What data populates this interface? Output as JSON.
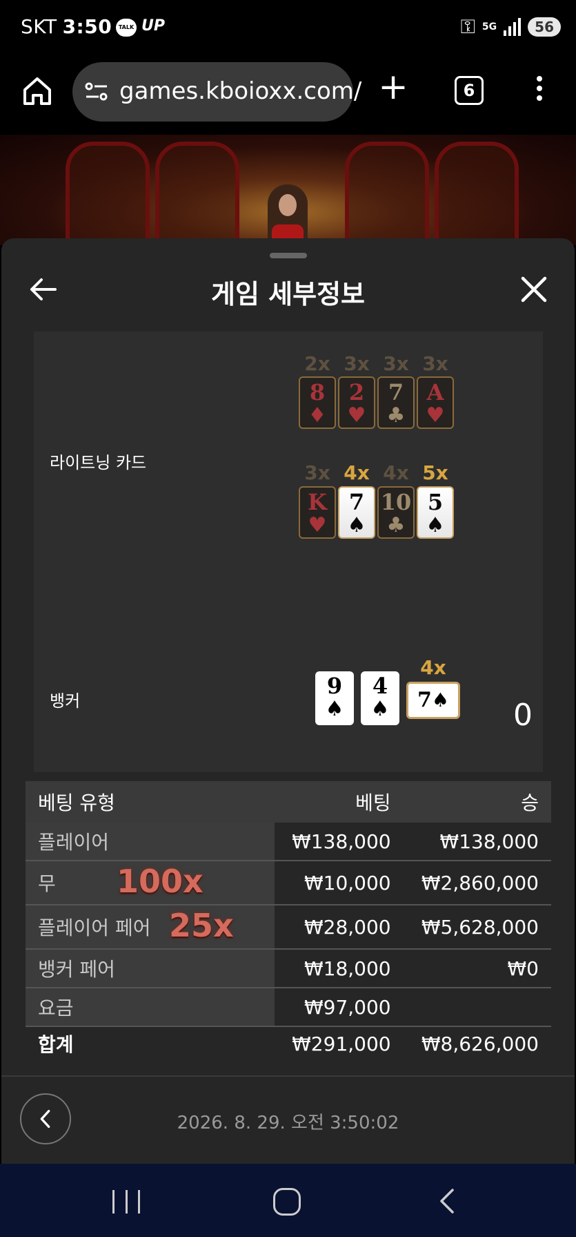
{
  "status_bar": {
    "carrier": "SKT",
    "time": "3:50",
    "talk_badge": "TALK",
    "up_badge": "UP",
    "network": "5G",
    "battery": "56"
  },
  "browser": {
    "url": "games.kboioxx.com/",
    "tab_count": "6"
  },
  "panel": {
    "title": "게임 세부정보",
    "lightning_label": "라이트닝 카드",
    "banker_label": "뱅커",
    "banker_score": "0",
    "lightning_cards": [
      {
        "rank": "8",
        "suit": "♦",
        "multiplier": "2x",
        "color": "red",
        "active": false
      },
      {
        "rank": "2",
        "suit": "♥",
        "multiplier": "3x",
        "color": "red",
        "active": false
      },
      {
        "rank": "7",
        "suit": "♣",
        "multiplier": "3x",
        "color": "black",
        "active": false
      },
      {
        "rank": "A",
        "suit": "♥",
        "multiplier": "3x",
        "color": "red",
        "active": false
      },
      {
        "rank": "K",
        "suit": "♥",
        "multiplier": "3x",
        "color": "red",
        "active": false
      },
      {
        "rank": "7",
        "suit": "♠",
        "multiplier": "4x",
        "color": "black",
        "active": true
      },
      {
        "rank": "10",
        "suit": "♣",
        "multiplier": "4x",
        "color": "black",
        "active": false
      },
      {
        "rank": "5",
        "suit": "♠",
        "multiplier": "5x",
        "color": "black",
        "active": true
      }
    ],
    "banker_cards": [
      {
        "rank": "9",
        "suit": "♠"
      },
      {
        "rank": "4",
        "suit": "♠"
      },
      {
        "rank": "7",
        "suit": "♠",
        "multiplier": "4x"
      }
    ]
  },
  "bets": {
    "headers": {
      "type": "베팅 유형",
      "bet": "베팅",
      "win": "승"
    },
    "rows": [
      {
        "type": "플레이어",
        "bet": "₩138,000",
        "win": "₩138,000",
        "boost": ""
      },
      {
        "type": "무",
        "bet": "₩10,000",
        "win": "₩2,860,000",
        "boost": "100x"
      },
      {
        "type": "플레이어 페어",
        "bet": "₩28,000",
        "win": "₩5,628,000",
        "boost": "25x"
      },
      {
        "type": "뱅커 페어",
        "bet": "₩18,000",
        "win": "₩0",
        "boost": ""
      },
      {
        "type": "요금",
        "bet": "₩97,000",
        "win": "",
        "boost": ""
      }
    ],
    "total": {
      "type": "합계",
      "bet": "₩291,000",
      "win": "₩8,626,000"
    }
  },
  "timestamp": "2026. 8. 29. 오전 3:50:02",
  "colors": {
    "panel_bg": "#262626",
    "card_area_bg": "#2e2e2e",
    "gold_active": "#d8a640",
    "gold_dim": "#5e5140",
    "boost_red": "#d46b5c",
    "nav_bg": "#0a1232"
  }
}
